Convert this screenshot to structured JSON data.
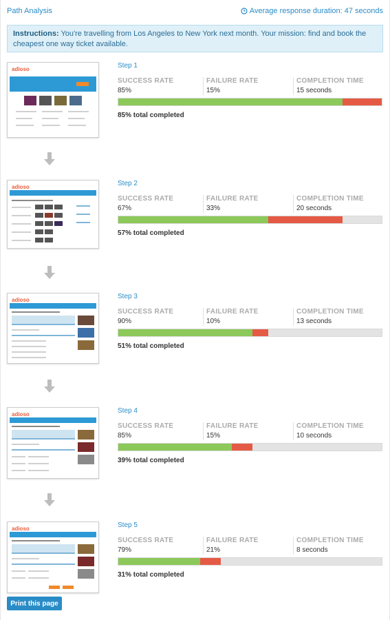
{
  "header": {
    "title": "Path Analysis",
    "avg_label": "Average response duration: 47 seconds"
  },
  "instructions": {
    "label": "Instructions:",
    "text": "You're travelling from Los Angeles to New York next month. Your mission: find and book the cheapest one way ticket available."
  },
  "metric_labels": {
    "success": "SUCCESS RATE",
    "failure": "FAILURE RATE",
    "time": "COMPLETION TIME"
  },
  "thumbnail_logo": "adioso",
  "colors": {
    "success": "#8cc85a",
    "failure": "#e55a45",
    "remaining": "#e3e3e3",
    "accent": "#2a8cc7"
  },
  "steps": [
    {
      "title": "Step 1",
      "success": "85%",
      "failure": "15%",
      "time": "15 seconds",
      "total": "85% total completed",
      "completed_pct": 85,
      "failed_pct": 15
    },
    {
      "title": "Step 2",
      "success": "67%",
      "failure": "33%",
      "time": "20 seconds",
      "total": "57% total completed",
      "completed_pct": 57,
      "failed_pct": 28
    },
    {
      "title": "Step 3",
      "success": "90%",
      "failure": "10%",
      "time": "13 seconds",
      "total": "51% total completed",
      "completed_pct": 51,
      "failed_pct": 6
    },
    {
      "title": "Step 4",
      "success": "85%",
      "failure": "15%",
      "time": "10 seconds",
      "total": "39% total completed",
      "completed_pct": 43,
      "failed_pct": 8
    },
    {
      "title": "Step 5",
      "success": "79%",
      "failure": "21%",
      "time": "8 seconds",
      "total": "31% total completed",
      "completed_pct": 31,
      "failed_pct": 8
    }
  ],
  "print_button": "Print this page"
}
